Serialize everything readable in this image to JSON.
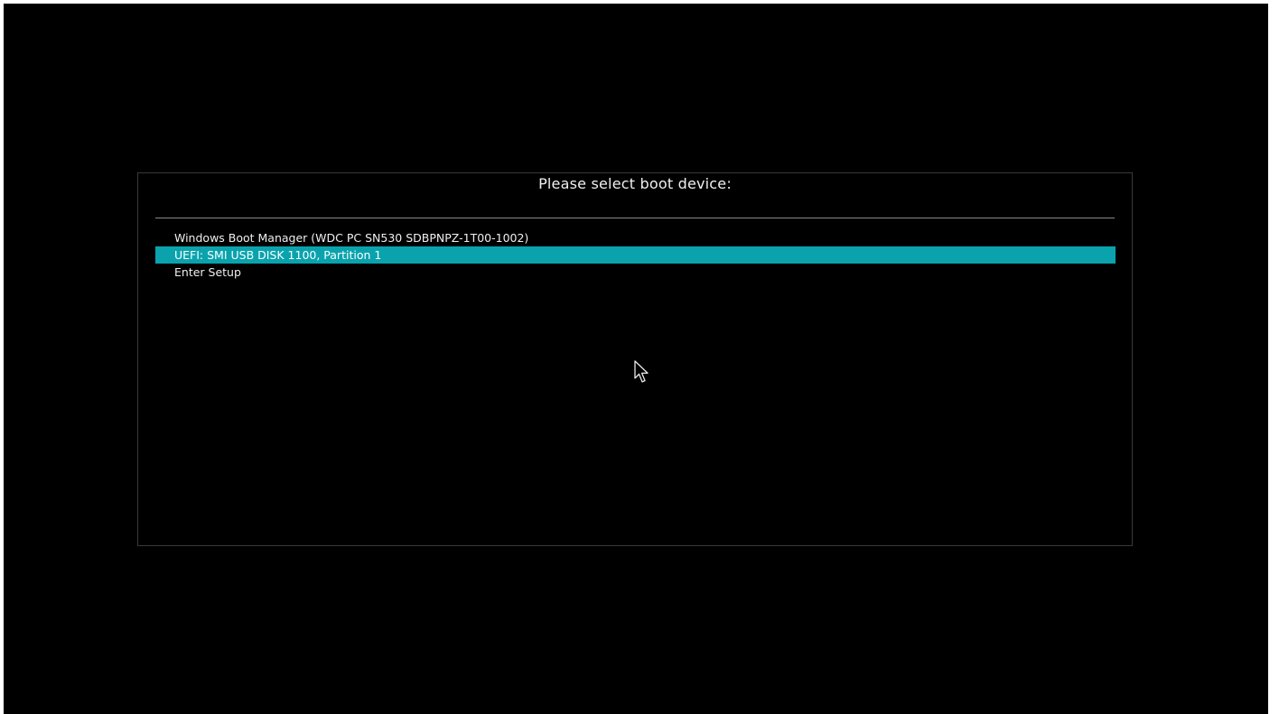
{
  "boot_menu": {
    "title": "Please select boot device:",
    "selected_index": 1,
    "options": [
      {
        "label": "Windows Boot Manager (WDC PC SN530 SDBPNPZ-1T00-1002)"
      },
      {
        "label": "UEFI: SMI USB DISK 1100, Partition 1"
      },
      {
        "label": "Enter Setup"
      }
    ]
  },
  "colors": {
    "background": "#000000",
    "text": "#f0f0f0",
    "highlight": "#0aa3ad",
    "frame_border": "#3a3a3a",
    "divider": "#8a8a8a"
  },
  "pointer": {
    "icon": "mouse-pointer-icon"
  }
}
